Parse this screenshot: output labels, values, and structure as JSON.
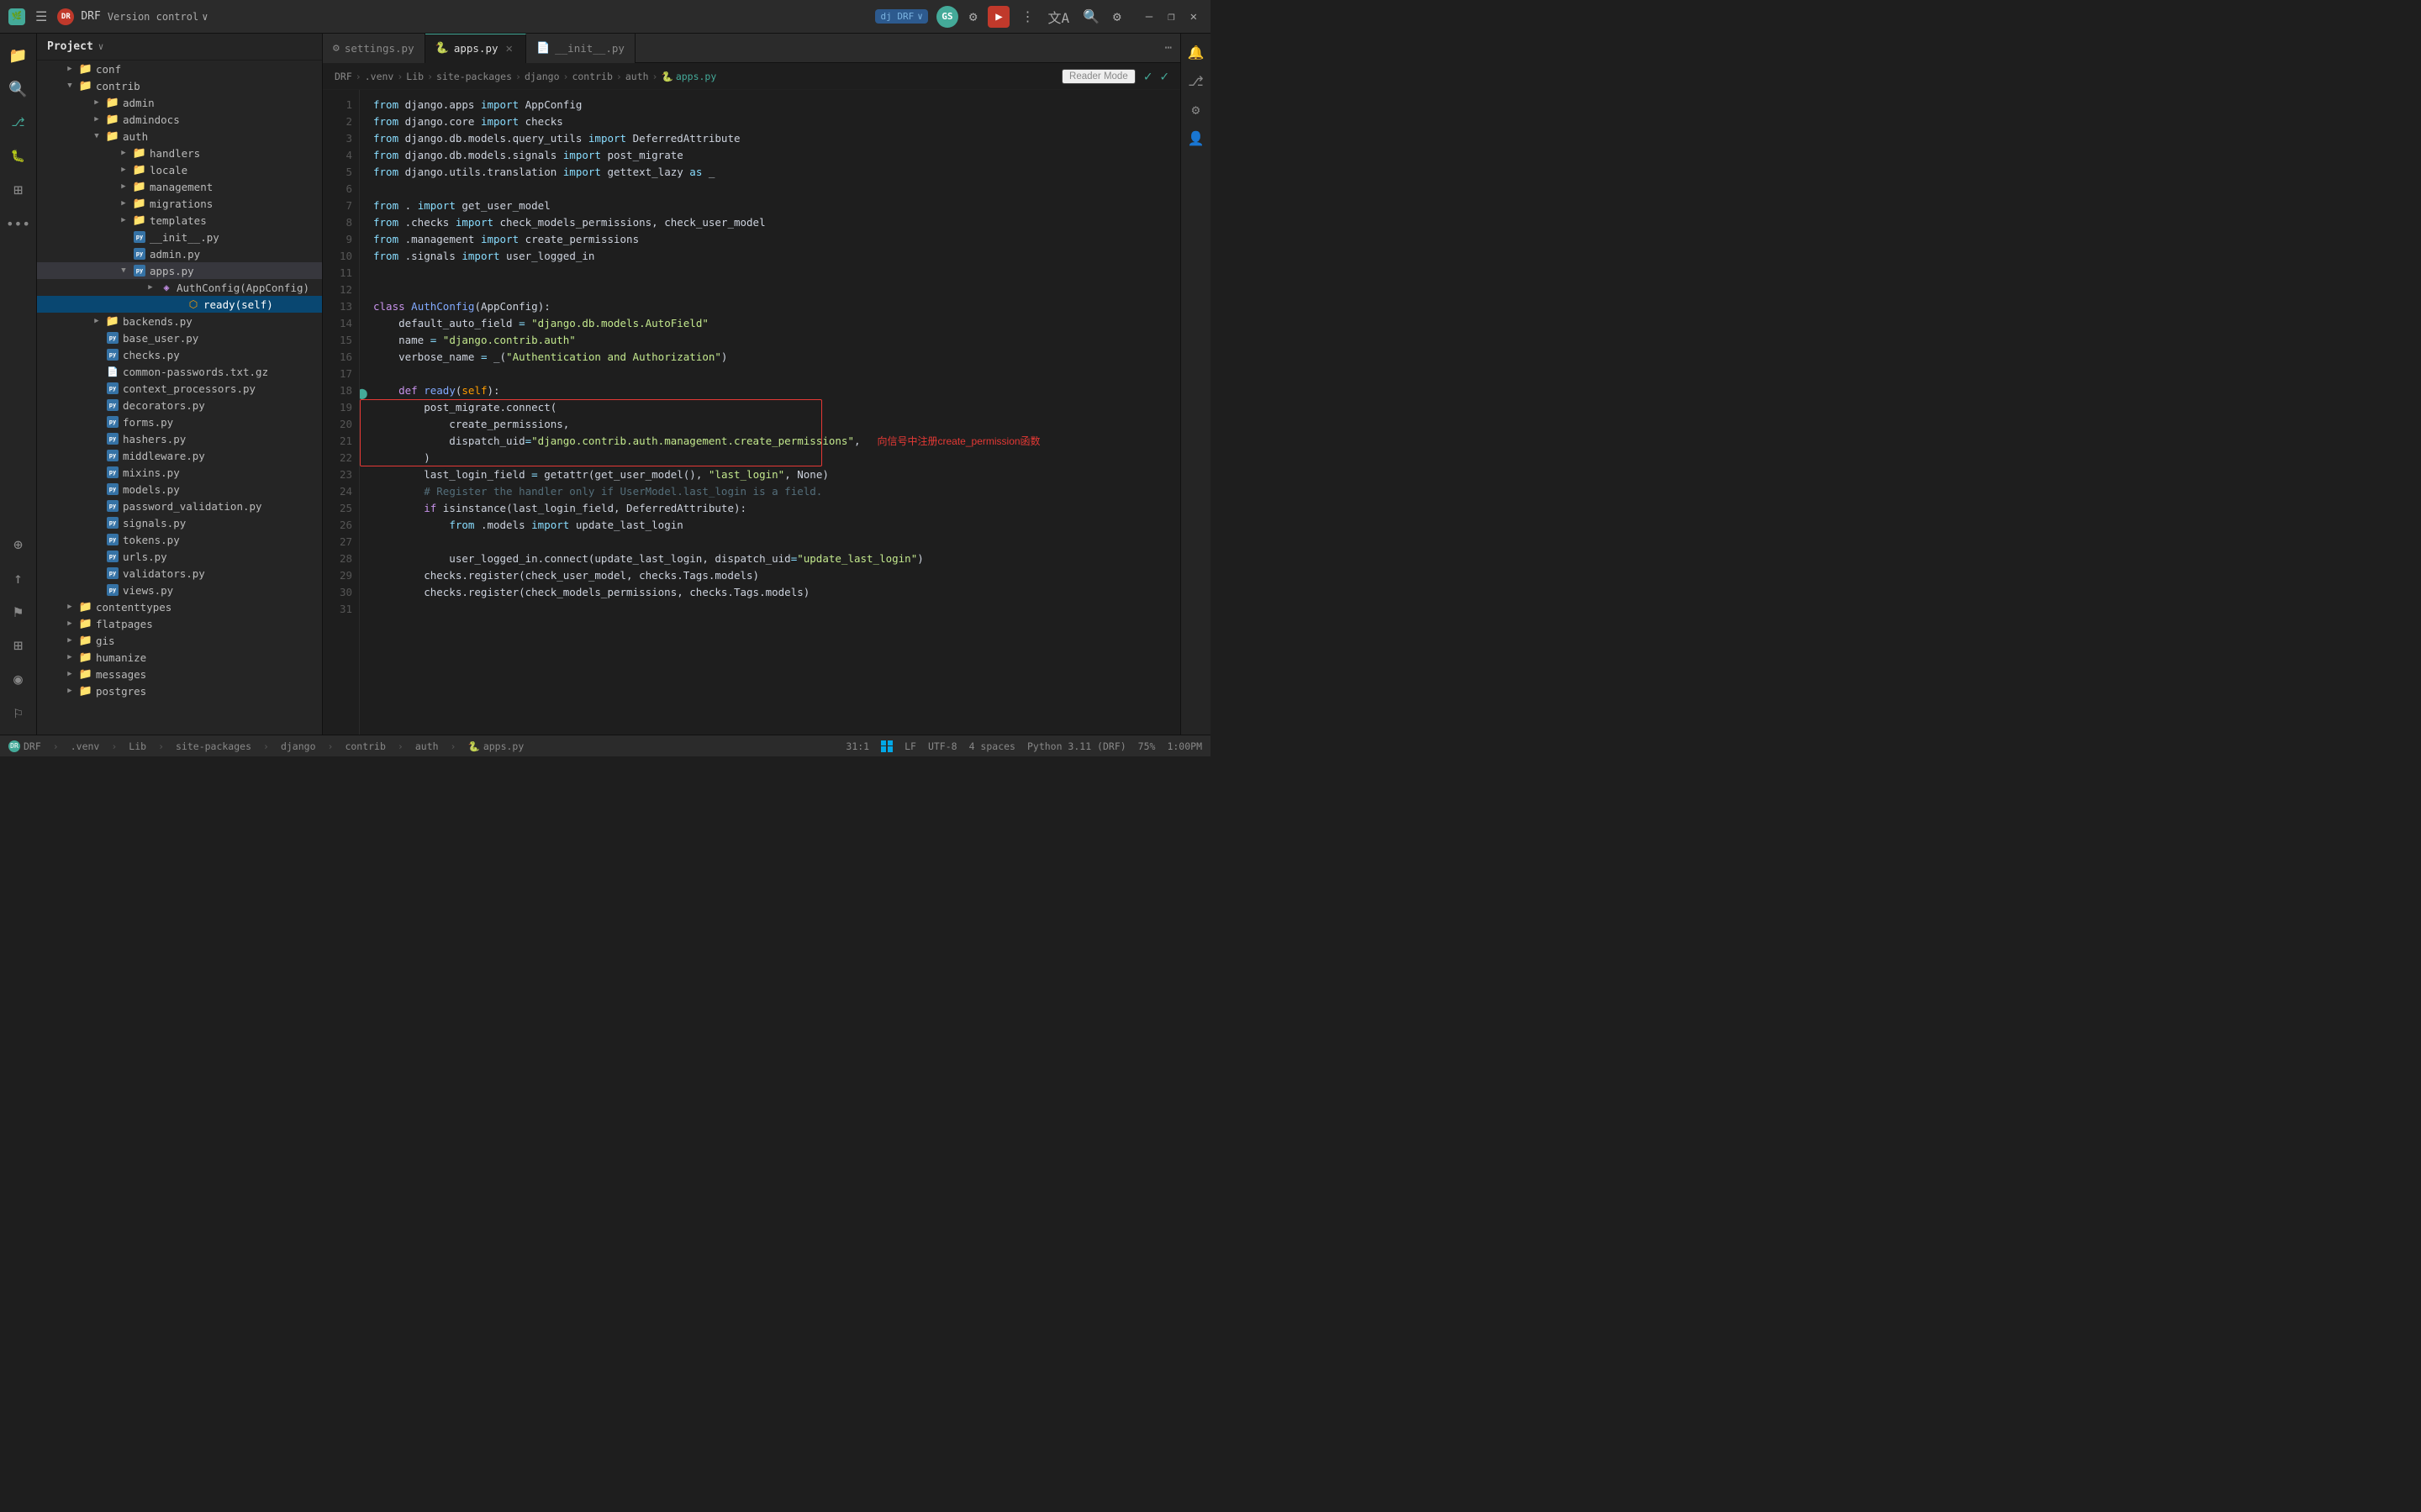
{
  "titlebar": {
    "logo": "🌿",
    "menu_icon": "☰",
    "project_badge": "DR",
    "project_name": "DRF",
    "version_control": "Version control",
    "dj_label": "dj DRF",
    "run_btn": "▶",
    "avatar": "GS",
    "win_btns": [
      "—",
      "❐",
      "✕"
    ]
  },
  "sidebar_icons": {
    "top": [
      "📁",
      "🔍",
      "⚙",
      "•••"
    ],
    "bottom": [
      "⊕",
      "↑",
      "⚑",
      "⊞",
      "◉",
      "⚐"
    ]
  },
  "file_tree": {
    "header": "Project",
    "items": [
      {
        "indent": 2,
        "type": "folder",
        "arrow": "▶",
        "label": "conf",
        "depth": 1
      },
      {
        "indent": 2,
        "type": "folder",
        "arrow": "▼",
        "label": "contrib",
        "depth": 1
      },
      {
        "indent": 4,
        "type": "folder",
        "arrow": "▶",
        "label": "admin",
        "depth": 2
      },
      {
        "indent": 4,
        "type": "folder",
        "arrow": "▶",
        "label": "admindocs",
        "depth": 2
      },
      {
        "indent": 4,
        "type": "folder",
        "arrow": "▼",
        "label": "auth",
        "depth": 2
      },
      {
        "indent": 6,
        "type": "folder",
        "arrow": "▶",
        "label": "handlers",
        "depth": 3
      },
      {
        "indent": 6,
        "type": "folder",
        "arrow": "▶",
        "label": "locale",
        "depth": 3
      },
      {
        "indent": 6,
        "type": "folder",
        "arrow": "▶",
        "label": "management",
        "depth": 3
      },
      {
        "indent": 6,
        "type": "folder",
        "arrow": "▶",
        "label": "migrations",
        "depth": 3
      },
      {
        "indent": 6,
        "type": "folder",
        "arrow": "▶",
        "label": "templates",
        "depth": 3
      },
      {
        "indent": 6,
        "type": "py",
        "arrow": "",
        "label": "__init__.py",
        "depth": 3
      },
      {
        "indent": 6,
        "type": "py",
        "arrow": "",
        "label": "admin.py",
        "depth": 3
      },
      {
        "indent": 6,
        "type": "py",
        "arrow": "▼",
        "label": "apps.py",
        "depth": 3,
        "active": true
      },
      {
        "indent": 8,
        "type": "cls",
        "arrow": "▶",
        "label": "AuthConfig(AppConfig)",
        "depth": 4
      },
      {
        "indent": 10,
        "type": "fn",
        "arrow": "",
        "label": "ready(self)",
        "depth": 5,
        "selected": true
      },
      {
        "indent": 4,
        "type": "folder",
        "arrow": "▶",
        "label": "backends.py",
        "depth": 2
      },
      {
        "indent": 4,
        "type": "py",
        "arrow": "",
        "label": "base_user.py",
        "depth": 2
      },
      {
        "indent": 4,
        "type": "py",
        "arrow": "",
        "label": "checks.py",
        "depth": 2
      },
      {
        "indent": 4,
        "type": "txt",
        "arrow": "",
        "label": "common-passwords.txt.gz",
        "depth": 2
      },
      {
        "indent": 4,
        "type": "py",
        "arrow": "",
        "label": "context_processors.py",
        "depth": 2
      },
      {
        "indent": 4,
        "type": "py",
        "arrow": "",
        "label": "decorators.py",
        "depth": 2
      },
      {
        "indent": 4,
        "type": "py",
        "arrow": "",
        "label": "forms.py",
        "depth": 2
      },
      {
        "indent": 4,
        "type": "py",
        "arrow": "",
        "label": "hashers.py",
        "depth": 2
      },
      {
        "indent": 4,
        "type": "py",
        "arrow": "",
        "label": "middleware.py",
        "depth": 2
      },
      {
        "indent": 4,
        "type": "py",
        "arrow": "",
        "label": "mixins.py",
        "depth": 2
      },
      {
        "indent": 4,
        "type": "py",
        "arrow": "",
        "label": "models.py",
        "depth": 2
      },
      {
        "indent": 4,
        "type": "py",
        "arrow": "",
        "label": "password_validation.py",
        "depth": 2
      },
      {
        "indent": 4,
        "type": "py",
        "arrow": "",
        "label": "signals.py",
        "depth": 2
      },
      {
        "indent": 4,
        "type": "py",
        "arrow": "",
        "label": "tokens.py",
        "depth": 2
      },
      {
        "indent": 4,
        "type": "py",
        "arrow": "",
        "label": "urls.py",
        "depth": 2
      },
      {
        "indent": 4,
        "type": "py",
        "arrow": "",
        "label": "validators.py",
        "depth": 2
      },
      {
        "indent": 4,
        "type": "py",
        "arrow": "",
        "label": "views.py",
        "depth": 2
      },
      {
        "indent": 2,
        "type": "folder",
        "arrow": "▶",
        "label": "contenttypes",
        "depth": 1
      },
      {
        "indent": 2,
        "type": "folder",
        "arrow": "▶",
        "label": "flatpages",
        "depth": 1
      },
      {
        "indent": 2,
        "type": "folder",
        "arrow": "▶",
        "label": "gis",
        "depth": 1
      },
      {
        "indent": 2,
        "type": "folder",
        "arrow": "▶",
        "label": "humanize",
        "depth": 1
      },
      {
        "indent": 2,
        "type": "folder",
        "arrow": "▶",
        "label": "messages",
        "depth": 1
      },
      {
        "indent": 2,
        "type": "folder",
        "arrow": "▶",
        "label": "postgres",
        "depth": 1
      }
    ]
  },
  "tabs": [
    {
      "label": "settings.py",
      "icon": "⚙",
      "active": false,
      "closable": false
    },
    {
      "label": "apps.py",
      "icon": "🐍",
      "active": true,
      "closable": true
    },
    {
      "label": "__init__.py",
      "icon": "📄",
      "active": false,
      "closable": false
    }
  ],
  "editor": {
    "reader_mode": "Reader Mode",
    "breadcrumb": [
      "DRF",
      ".venv",
      "Lib",
      "site-packages",
      "django",
      "contrib",
      "auth",
      "apps.py"
    ],
    "filename": "apps.py"
  },
  "code_lines": [
    {
      "n": 1,
      "tokens": [
        {
          "t": "kw2",
          "v": "from"
        },
        {
          "t": "plain",
          "v": " django.apps "
        },
        {
          "t": "kw2",
          "v": "import"
        },
        {
          "t": "plain",
          "v": " AppConfig"
        }
      ]
    },
    {
      "n": 2,
      "tokens": [
        {
          "t": "kw2",
          "v": "from"
        },
        {
          "t": "plain",
          "v": " django.core "
        },
        {
          "t": "kw2",
          "v": "import"
        },
        {
          "t": "plain",
          "v": " checks"
        }
      ]
    },
    {
      "n": 3,
      "tokens": [
        {
          "t": "kw2",
          "v": "from"
        },
        {
          "t": "plain",
          "v": " django.db.models.query_utils "
        },
        {
          "t": "kw2",
          "v": "import"
        },
        {
          "t": "plain",
          "v": " DeferredAttribute"
        }
      ]
    },
    {
      "n": 4,
      "tokens": [
        {
          "t": "kw2",
          "v": "from"
        },
        {
          "t": "plain",
          "v": " django.db.models.signals "
        },
        {
          "t": "kw2",
          "v": "import"
        },
        {
          "t": "plain",
          "v": " post_migrate"
        }
      ]
    },
    {
      "n": 5,
      "tokens": [
        {
          "t": "kw2",
          "v": "from"
        },
        {
          "t": "plain",
          "v": " django.utils.translation "
        },
        {
          "t": "kw2",
          "v": "import"
        },
        {
          "t": "plain",
          "v": " gettext_lazy "
        },
        {
          "t": "kw2",
          "v": "as"
        },
        {
          "t": "plain",
          "v": " _"
        }
      ]
    },
    {
      "n": 6,
      "tokens": []
    },
    {
      "n": 7,
      "tokens": [
        {
          "t": "kw2",
          "v": "from"
        },
        {
          "t": "plain",
          "v": " . "
        },
        {
          "t": "kw2",
          "v": "import"
        },
        {
          "t": "plain",
          "v": " get_user_model"
        }
      ]
    },
    {
      "n": 8,
      "tokens": [
        {
          "t": "kw2",
          "v": "from"
        },
        {
          "t": "plain",
          "v": " .checks "
        },
        {
          "t": "kw2",
          "v": "import"
        },
        {
          "t": "plain",
          "v": " check_models_permissions, check_user_model"
        }
      ]
    },
    {
      "n": 9,
      "tokens": [
        {
          "t": "kw2",
          "v": "from"
        },
        {
          "t": "plain",
          "v": " .management "
        },
        {
          "t": "kw2",
          "v": "import"
        },
        {
          "t": "plain",
          "v": " create_permissions"
        }
      ]
    },
    {
      "n": 10,
      "tokens": [
        {
          "t": "kw2",
          "v": "from"
        },
        {
          "t": "plain",
          "v": " .signals "
        },
        {
          "t": "kw2",
          "v": "import"
        },
        {
          "t": "plain",
          "v": " user_logged_in"
        }
      ]
    },
    {
      "n": 11,
      "tokens": []
    },
    {
      "n": 12,
      "tokens": []
    },
    {
      "n": 13,
      "tokens": [
        {
          "t": "kw",
          "v": "class"
        },
        {
          "t": "plain",
          "v": " "
        },
        {
          "t": "cls",
          "v": "AuthConfig"
        },
        {
          "t": "plain",
          "v": "(AppConfig):"
        }
      ]
    },
    {
      "n": 14,
      "tokens": [
        {
          "t": "plain",
          "v": "    default_auto_field "
        },
        {
          "t": "eq",
          "v": "="
        },
        {
          "t": "plain",
          "v": " "
        },
        {
          "t": "str",
          "v": "\"django.db.models.AutoField\""
        }
      ]
    },
    {
      "n": 15,
      "tokens": [
        {
          "t": "plain",
          "v": "    name "
        },
        {
          "t": "eq",
          "v": "="
        },
        {
          "t": "plain",
          "v": " "
        },
        {
          "t": "str",
          "v": "\"django.contrib.auth\""
        }
      ]
    },
    {
      "n": 16,
      "tokens": [
        {
          "t": "plain",
          "v": "    verbose_name "
        },
        {
          "t": "eq",
          "v": "="
        },
        {
          "t": "plain",
          "v": " _("
        },
        {
          "t": "str",
          "v": "\"Authentication and Authorization\""
        },
        {
          "t": "plain",
          "v": ")"
        }
      ]
    },
    {
      "n": 17,
      "tokens": []
    },
    {
      "n": 18,
      "tokens": [
        {
          "t": "plain",
          "v": "    "
        },
        {
          "t": "kw",
          "v": "def"
        },
        {
          "t": "plain",
          "v": " "
        },
        {
          "t": "fn",
          "v": "ready"
        },
        {
          "t": "plain",
          "v": "("
        },
        {
          "t": "self-kw",
          "v": "self"
        },
        {
          "t": "plain",
          "v": "):"
        }
      ],
      "indicator": true
    },
    {
      "n": 19,
      "tokens": [
        {
          "t": "plain",
          "v": "        post_migrate.connect("
        }
      ],
      "boxed": true
    },
    {
      "n": 20,
      "tokens": [
        {
          "t": "plain",
          "v": "            create_permissions,"
        }
      ],
      "boxed": true
    },
    {
      "n": 21,
      "tokens": [
        {
          "t": "plain",
          "v": "            dispatch_uid"
        },
        {
          "t": "eq",
          "v": "="
        },
        {
          "t": "str",
          "v": "\"django.contrib.auth.management.create_permissions\""
        },
        {
          "t": "plain",
          "v": ","
        }
      ],
      "boxed": true
    },
    {
      "n": 22,
      "tokens": [
        {
          "t": "plain",
          "v": "        )"
        }
      ],
      "boxed": true
    },
    {
      "n": 23,
      "tokens": [
        {
          "t": "plain",
          "v": "        last_login_field "
        },
        {
          "t": "eq",
          "v": "="
        },
        {
          "t": "plain",
          "v": " getattr(get_user_model(), "
        },
        {
          "t": "str",
          "v": "\"last_login\""
        },
        {
          "t": "plain",
          "v": ", None)"
        }
      ]
    },
    {
      "n": 24,
      "tokens": [
        {
          "t": "plain",
          "v": "        "
        },
        {
          "t": "cmt",
          "v": "# Register the handler only if UserModel.last_login is a field."
        }
      ]
    },
    {
      "n": 25,
      "tokens": [
        {
          "t": "plain",
          "v": "        "
        },
        {
          "t": "kw",
          "v": "if"
        },
        {
          "t": "plain",
          "v": " isinstance(last_login_field, DeferredAttribute):"
        }
      ]
    },
    {
      "n": 26,
      "tokens": [
        {
          "t": "plain",
          "v": "            "
        },
        {
          "t": "kw2",
          "v": "from"
        },
        {
          "t": "plain",
          "v": " .models "
        },
        {
          "t": "kw2",
          "v": "import"
        },
        {
          "t": "plain",
          "v": " update_last_login"
        }
      ]
    },
    {
      "n": 27,
      "tokens": []
    },
    {
      "n": 28,
      "tokens": [
        {
          "t": "plain",
          "v": "            user_logged_in.connect(update_last_login, dispatch_uid"
        },
        {
          "t": "eq",
          "v": "="
        },
        {
          "t": "str",
          "v": "\"update_last_login\""
        },
        {
          "t": "plain",
          "v": ")"
        }
      ]
    },
    {
      "n": 29,
      "tokens": [
        {
          "t": "plain",
          "v": "        checks.register(check_user_model, checks.Tags.models)"
        }
      ]
    },
    {
      "n": 30,
      "tokens": [
        {
          "t": "plain",
          "v": "        checks.register(check_models_permissions, checks.Tags.models)"
        }
      ]
    },
    {
      "n": 31,
      "tokens": []
    }
  ],
  "annotation": "向信号中注册create_permission函数",
  "status_bar": {
    "drf_label": "DRF",
    "venv_label": ".venv",
    "lib_label": "Lib",
    "site_packages_label": "site-packages",
    "django_label": "django",
    "contrib_label": "contrib",
    "auth_label": "auth",
    "file_label": "apps.py",
    "position": "31:1",
    "lf_label": "LF",
    "encoding": "UTF-8",
    "indent": "4 spaces",
    "python_version": "Python 3.11 (DRF)",
    "zoom": "75%",
    "right_status": "1:00PM"
  }
}
